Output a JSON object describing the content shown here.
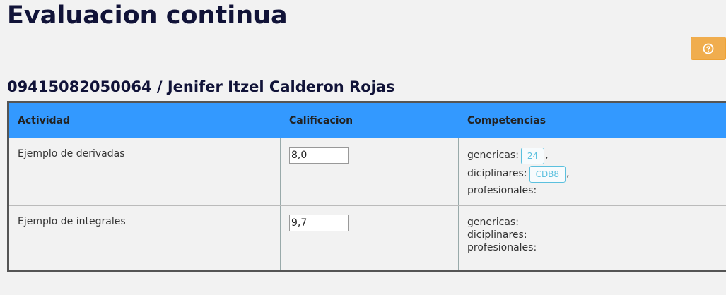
{
  "page": {
    "title": "Evaluacion continua",
    "help_icon": "question-circle-icon",
    "help_color": "#f0ad4e"
  },
  "student": {
    "header": "09415082050064 / Jenifer Itzel Calderon Rojas"
  },
  "table": {
    "header_color": "#3399ff",
    "columns": [
      "Actividad",
      "Calificacion",
      "Competencias"
    ],
    "rows": [
      {
        "actividad": "Ejemplo de derivadas",
        "calificacion": "8,0",
        "genericas_label": "genericas:",
        "genericas_tag": "24",
        "diciplinares_label": "diciplinares:",
        "diciplinares_tag": "CDB8",
        "profesionales_label": "profesionales:"
      },
      {
        "actividad": "Ejemplo de integrales",
        "calificacion": "9,7",
        "genericas_label": "genericas:",
        "diciplinares_label": "diciplinares:",
        "profesionales_label": "profesionales:"
      }
    ],
    "separator": ","
  }
}
